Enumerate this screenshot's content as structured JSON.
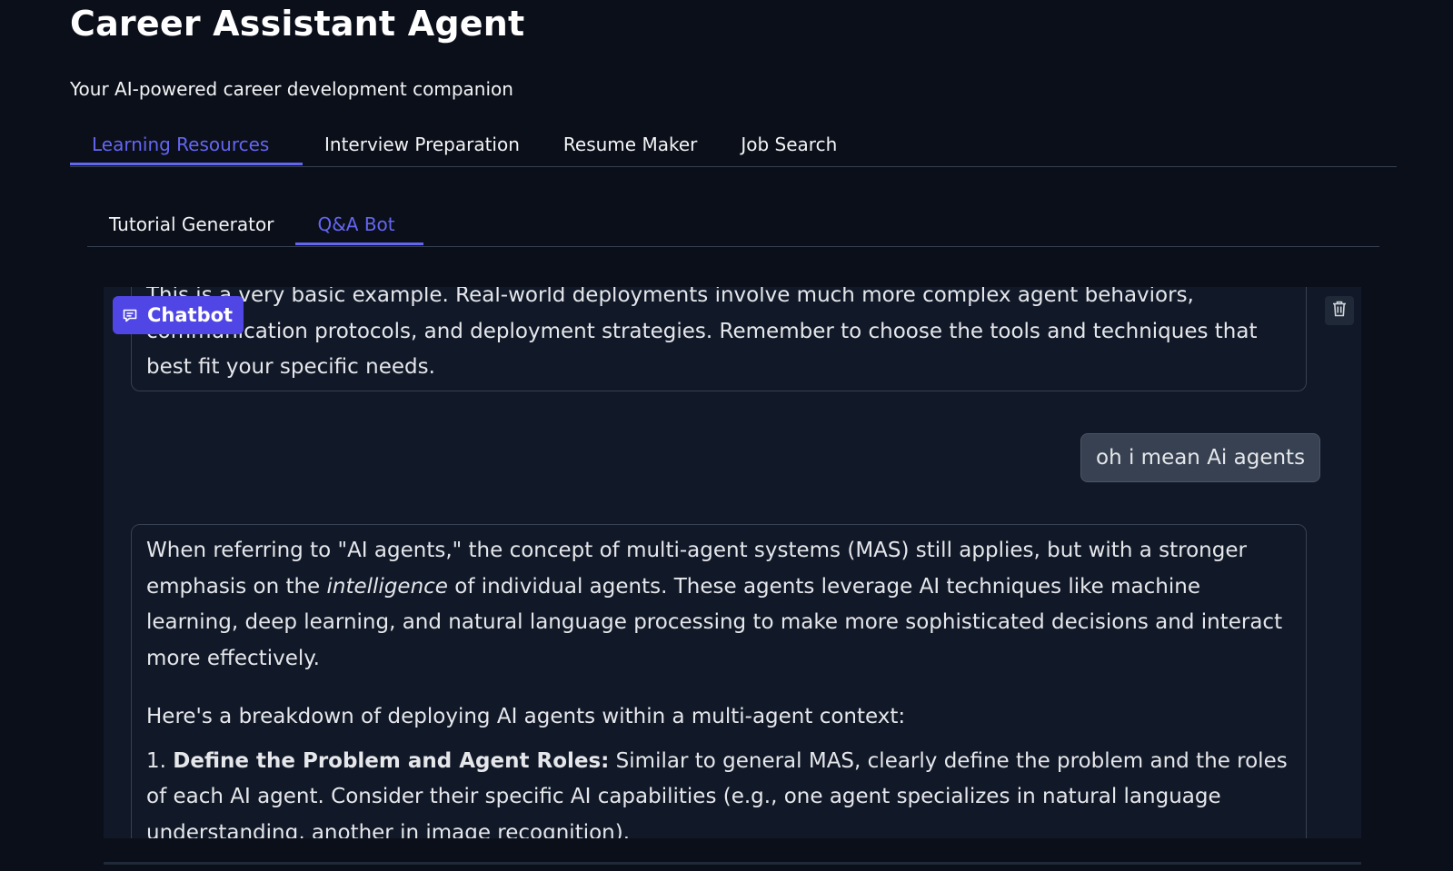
{
  "app": {
    "title": "Career Assistant Agent",
    "subtitle": "Your AI-powered career development companion"
  },
  "main_tabs": [
    {
      "label": "Learning Resources",
      "active": true
    },
    {
      "label": "Interview Preparation",
      "active": false
    },
    {
      "label": "Resume Maker",
      "active": false
    },
    {
      "label": "Job Search",
      "active": false
    }
  ],
  "sub_tabs": [
    {
      "label": "Tutorial Generator",
      "active": false
    },
    {
      "label": "Q&A Bot",
      "active": true
    }
  ],
  "chatbot": {
    "label": "Chatbot",
    "label_icon": "chat-bubble-icon",
    "clear_icon": "trash-icon",
    "messages": [
      {
        "role": "bot",
        "text": "This is a very basic example. Real-world deployments involve much more complex agent behaviors, communication protocols, and deployment strategies. Remember to choose the tools and techniques that best fit your specific needs."
      },
      {
        "role": "user",
        "text": "oh i mean Ai agents"
      },
      {
        "role": "bot",
        "para1_before": "When referring to \"AI agents,\" the concept of multi-agent systems (MAS) still applies, but with a stronger emphasis on the ",
        "para1_italic": "intelligence",
        "para1_after": " of individual agents. These agents leverage AI techniques like machine learning, deep learning, and natural language processing to make more sophisticated decisions and interact more effectively.",
        "para2": "Here's a breakdown of deploying AI agents within a multi-agent context:",
        "list_number": "1.",
        "list_bold": "Define the Problem and Agent Roles:",
        "list_text": " Similar to general MAS, clearly define the problem and the roles of each AI agent. Consider their specific AI capabilities (e.g., one agent specializes in natural language understanding, another in image recognition)."
      }
    ]
  },
  "colors": {
    "background": "#0b0f19",
    "panel": "#111827",
    "accent": "#6366f1",
    "chat_label_bg": "#4f46e5",
    "user_bubble": "#374151",
    "border": "#374151"
  }
}
